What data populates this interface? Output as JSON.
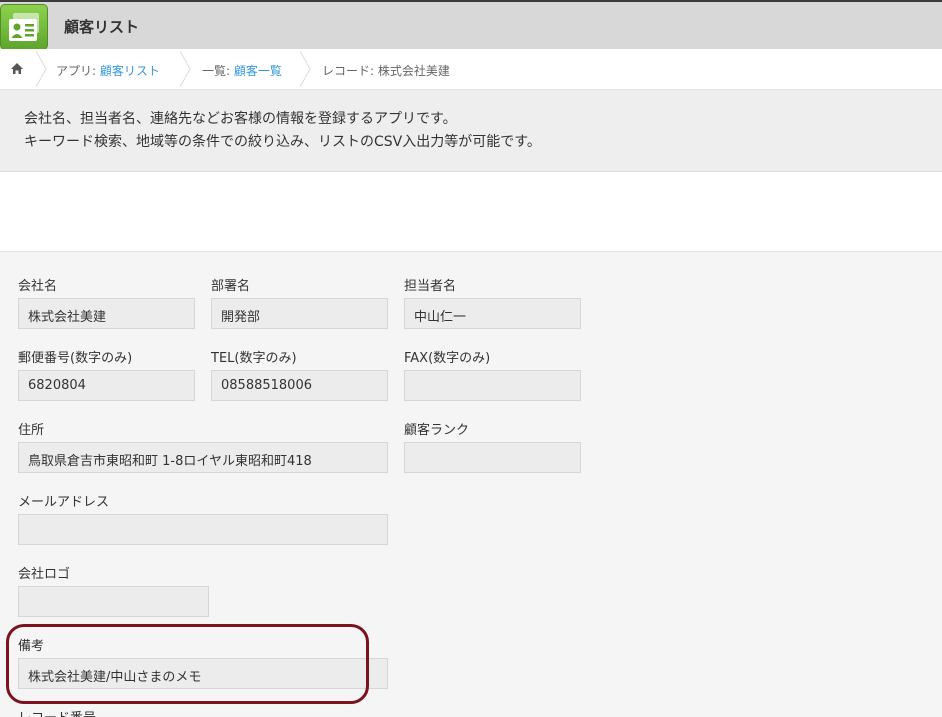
{
  "app": {
    "title": "顧客リスト"
  },
  "breadcrumb": {
    "app_prefix": "アプリ: ",
    "app_link": "顧客リスト",
    "list_prefix": "一覧: ",
    "list_link": "顧客一覧",
    "record": "レコード: 株式会社美建"
  },
  "description": {
    "line1": "会社名、担当者名、連絡先などお客様の情報を登録するアプリです。",
    "line2": "キーワード検索、地域等の条件での絞り込み、リストのCSV入出力等が可能です。"
  },
  "fields": {
    "company_name": {
      "label": "会社名",
      "value": "株式会社美建"
    },
    "department": {
      "label": "部署名",
      "value": "開発部"
    },
    "contact_person": {
      "label": "担当者名",
      "value": "中山仁一"
    },
    "postal_code": {
      "label": "郵便番号(数字のみ)",
      "value": "6820804"
    },
    "tel": {
      "label": "TEL(数字のみ)",
      "value": "08588518006"
    },
    "fax": {
      "label": "FAX(数字のみ)",
      "value": ""
    },
    "address": {
      "label": "住所",
      "value": "鳥取県倉吉市東昭和町 1-8ロイヤル東昭和町418"
    },
    "customer_rank": {
      "label": "顧客ランク",
      "value": ""
    },
    "email": {
      "label": "メールアドレス",
      "value": ""
    },
    "company_logo": {
      "label": "会社ロゴ",
      "value": ""
    },
    "notes": {
      "label": "備考",
      "value": "株式会社美建/中山さまのメモ"
    },
    "record_number": {
      "label": "レコード番号"
    }
  },
  "colors": {
    "highlight": "#7b1220",
    "link": "#3498db",
    "app_icon": "#6cbb3c"
  },
  "icons": {
    "app": "contact-card-icon",
    "home": "home-icon"
  }
}
